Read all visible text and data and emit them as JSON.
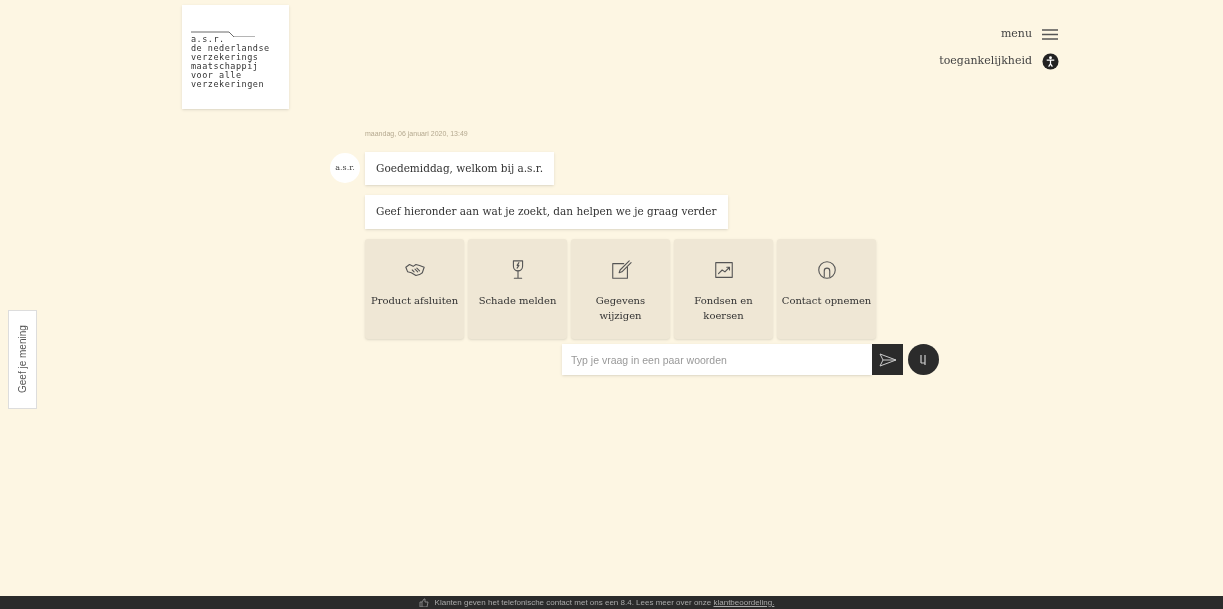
{
  "logo": {
    "lines": [
      "a.s.r.",
      "de nederlandse",
      "verzekerings",
      "maatschappij",
      "voor alle",
      "verzekeringen"
    ]
  },
  "header": {
    "menu": "menu",
    "accessibility": "toegankelijkheid"
  },
  "feedback_tab": "Geef je mening",
  "chat": {
    "timestamp": "maandag, 06 januari 2020, 13:49",
    "avatar": "a.s.r.",
    "messages": [
      "Goedemiddag, welkom bij a.s.r.",
      "Geef hieronder aan wat je zoekt, dan helpen we je graag verder"
    ],
    "options": [
      {
        "kind": "handshake",
        "label": "Product afsluiten"
      },
      {
        "kind": "glass",
        "label": "Schade melden"
      },
      {
        "kind": "edit",
        "label": "Gegevens wijzigen"
      },
      {
        "kind": "chart",
        "label": "Fondsen en koersen"
      },
      {
        "kind": "person",
        "label": "Contact opnemen"
      }
    ],
    "input": {
      "placeholder": "Typ je vraag in een paar woorden"
    }
  },
  "footer": {
    "text": "Klanten geven het telefonische contact met ons een 8.4. Lees meer over onze ",
    "link": "klantbeoordeling."
  }
}
